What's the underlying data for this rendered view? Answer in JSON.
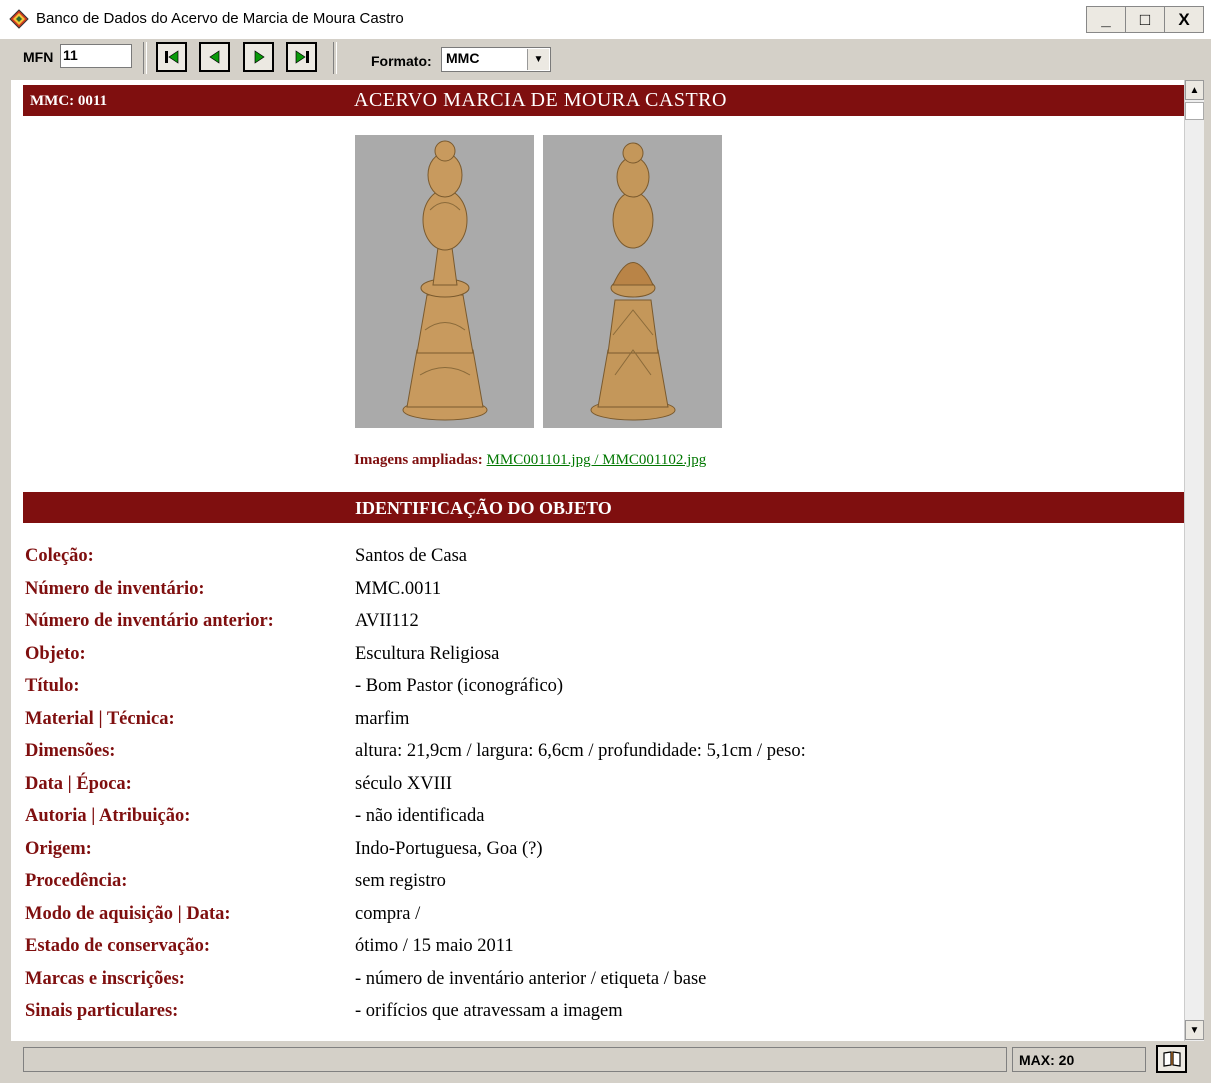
{
  "window": {
    "title": "Banco de Dados do Acervo de Marcia de Moura Castro",
    "minimize": "_",
    "maximize": "□",
    "close": "X"
  },
  "toolbar": {
    "mfn_label": "MFN",
    "mfn_value": "11",
    "nav_icons": [
      "first-record-icon",
      "previous-record-icon",
      "next-record-icon",
      "last-record-icon"
    ],
    "format_label": "Formato:",
    "format_value": "MMC"
  },
  "header": {
    "code": "MMC: 0011",
    "title": "ACERVO MARCIA DE MOURA CASTRO"
  },
  "images": {
    "label": "Imagens ampliadas:",
    "links": "MMC001101.jpg / MMC001102.jpg"
  },
  "section": {
    "title": "IDENTIFICAÇÃO DO OBJETO"
  },
  "fields": [
    {
      "label": "Coleção:",
      "value": "Santos de Casa"
    },
    {
      "label": "Número de inventário:",
      "value": "MMC.0011"
    },
    {
      "label": "Número de inventário anterior:",
      "value": "AVII112"
    },
    {
      "label": "Objeto:",
      "value": "Escultura Religiosa"
    },
    {
      "label": "Título:",
      "value": "- Bom Pastor (iconográfico)"
    },
    {
      "label": "Material | Técnica:",
      "value": "marfim"
    },
    {
      "label": "Dimensões:",
      "value": "altura: 21,9cm  /  largura: 6,6cm  /  profundidade: 5,1cm  /  peso:"
    },
    {
      "label": "Data | Época:",
      "value": "século XVIII"
    },
    {
      "label": "Autoria | Atribuição:",
      "value": "- não identificada"
    },
    {
      "label": "Origem:",
      "value": "Indo-Portuguesa, Goa (?)"
    },
    {
      "label": "Procedência:",
      "value": "sem registro"
    },
    {
      "label": "Modo de aquisição | Data:",
      "value": "compra /"
    },
    {
      "label": "Estado de conservação:",
      "value": "ótimo / 15 maio 2011"
    },
    {
      "label": "Marcas e inscrições:",
      "value": "- número de inventário anterior / etiqueta / base"
    },
    {
      "label": "Sinais particulares:",
      "value": "- orifícios que atravessam a imagem"
    }
  ],
  "status": {
    "max": "MAX: 20"
  },
  "colors": {
    "accent": "#7f0f0f",
    "link": "#007700"
  }
}
